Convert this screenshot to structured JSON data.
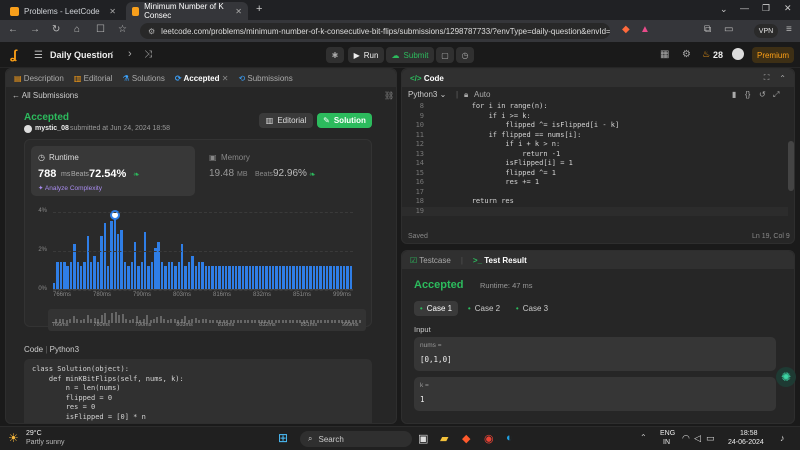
{
  "browser": {
    "tabs": [
      {
        "label": "Problems - LeetCode"
      },
      {
        "label": "Minimum Number of K Consec"
      }
    ],
    "url": "leetcode.com/problems/minimum-number-of-k-consecutive-bit-flips/submissions/1298787733/?envType=daily-question&envId=20...",
    "vpn": "VPN"
  },
  "header": {
    "title": "Daily Question",
    "run": "Run",
    "submit": "Submit",
    "streak": "28",
    "premium": "Premium"
  },
  "left_tabs": [
    "Description",
    "Editorial",
    "Solutions",
    "Accepted",
    "Submissions"
  ],
  "all_submissions": "All Submissions",
  "result": {
    "status": "Accepted",
    "user": "mystic_08",
    "submitted": "submitted at Jun 24, 2024 18:58",
    "editorial_btn": "Editorial",
    "solution_btn": "Solution"
  },
  "runtime": {
    "label": "Runtime",
    "value": "788",
    "unit": "ms",
    "beats_label": "Beats",
    "beats": "72.54%",
    "analyze": "Analyze Complexity"
  },
  "memory": {
    "label": "Memory",
    "value": "19.48",
    "unit": "MB",
    "beats_label": "Beats",
    "beats": "92.96%"
  },
  "chart_data": {
    "type": "bar",
    "ytick_labels": [
      "4%",
      "2%",
      "0%"
    ],
    "xtick_labels": [
      "766ms",
      "780ms",
      "790ms",
      "803ms",
      "816ms",
      "832ms",
      "851ms",
      "999ms"
    ],
    "mini_labels": [
      "766ms",
      "780ms",
      "790ms",
      "803ms",
      "816ms",
      "832ms",
      "851ms",
      "999ms"
    ],
    "ylim": [
      0,
      4.2
    ],
    "values": [
      0.3,
      1.4,
      1.4,
      1.4,
      1.2,
      1.4,
      2.3,
      1.4,
      1.2,
      1.4,
      2.7,
      1.4,
      1.7,
      1.4,
      2.7,
      3.4,
      1.2,
      3.5,
      3.7,
      2.8,
      3.0,
      1.4,
      1.2,
      1.4,
      2.4,
      1.2,
      1.4,
      2.9,
      1.2,
      1.4,
      2.1,
      2.4,
      1.4,
      1.2,
      1.4,
      1.4,
      1.2,
      1.4,
      2.3,
      1.2,
      1.4,
      1.7,
      1.2,
      1.4,
      1.4,
      1.2,
      1.2,
      1.2,
      1.2,
      1.2,
      1.2,
      1.2,
      1.2,
      1.2,
      1.2,
      1.2,
      1.2,
      1.2,
      1.2,
      1.2,
      1.2,
      1.2,
      1.2,
      1.2,
      1.2,
      1.2,
      1.2,
      1.2,
      1.2,
      1.2,
      1.2,
      1.2,
      1.2,
      1.2,
      1.2,
      1.2,
      1.2,
      1.2,
      1.2,
      1.2,
      1.2,
      1.2,
      1.2,
      1.2,
      1.2,
      1.2,
      1.2,
      1.2,
      1.2
    ],
    "highlight_index": 18
  },
  "code_section": {
    "label": "Code",
    "lang": "Python3",
    "lines": [
      "class Solution(object):",
      "    def minKBitFlips(self, nums, k):",
      "        n = len(nums)",
      "        flipped = 0",
      "        res = 0",
      "        isFlipped = [0] * n"
    ]
  },
  "editor": {
    "title": "Code",
    "lang": "Python3",
    "auto": "Auto",
    "saved": "Saved",
    "cursor": "Ln 19, Col 9",
    "lines": [
      {
        "n": "8",
        "t": "        for i in range(n):"
      },
      {
        "n": "9",
        "t": "            if i >= k:"
      },
      {
        "n": "10",
        "t": "                flipped ^= isFlipped[i - k]"
      },
      {
        "n": "11",
        "t": "            if flipped == nums[i]:"
      },
      {
        "n": "12",
        "t": "                if i + k > n:"
      },
      {
        "n": "13",
        "t": "                    return -1"
      },
      {
        "n": "14",
        "t": "                isFlipped[i] = 1"
      },
      {
        "n": "15",
        "t": "                flipped ^= 1"
      },
      {
        "n": "16",
        "t": "                res += 1"
      },
      {
        "n": "17",
        "t": ""
      },
      {
        "n": "18",
        "t": "        return res"
      },
      {
        "n": "19",
        "t": ""
      }
    ]
  },
  "testpanel": {
    "tab1": "Testcase",
    "tab2": "Test Result",
    "status": "Accepted",
    "runtime": "Runtime: 47 ms",
    "cases": [
      "Case 1",
      "Case 2",
      "Case 3"
    ],
    "input_label": "Input",
    "var1": "nums =",
    "val1": "[0,1,0]",
    "var2": "k =",
    "val2": "1"
  },
  "taskbar": {
    "weather_temp": "29°C",
    "weather_desc": "Partly sunny",
    "search": "Search",
    "lang1": "ENG",
    "lang2": "IN",
    "time": "18:58",
    "date": "24-06-2024"
  },
  "colors": {
    "accent_green": "#2cbb5d",
    "leetcode_orange": "#ffa116",
    "bar_blue": "#2f7ee6"
  }
}
